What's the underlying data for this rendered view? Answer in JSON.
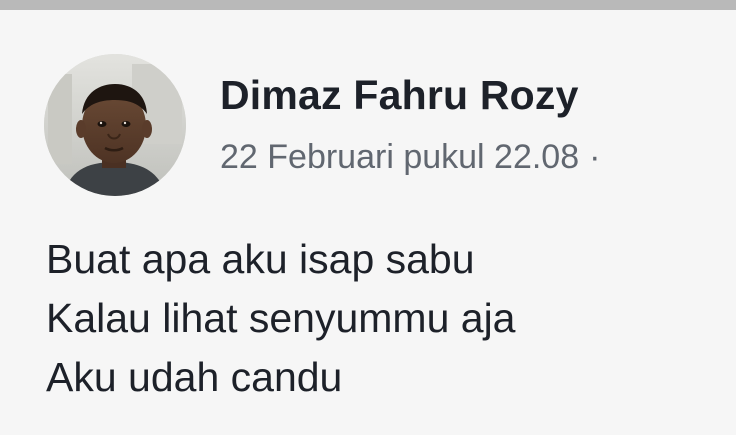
{
  "post": {
    "author": {
      "name": "Dimaz Fahru Rozy"
    },
    "meta": {
      "timestamp": "22 Februari pukul 22.08",
      "separator": "·"
    },
    "body_lines": [
      "Buat apa aku isap sabu",
      "Kalau lihat senyummu aja",
      "Aku udah candu"
    ]
  }
}
